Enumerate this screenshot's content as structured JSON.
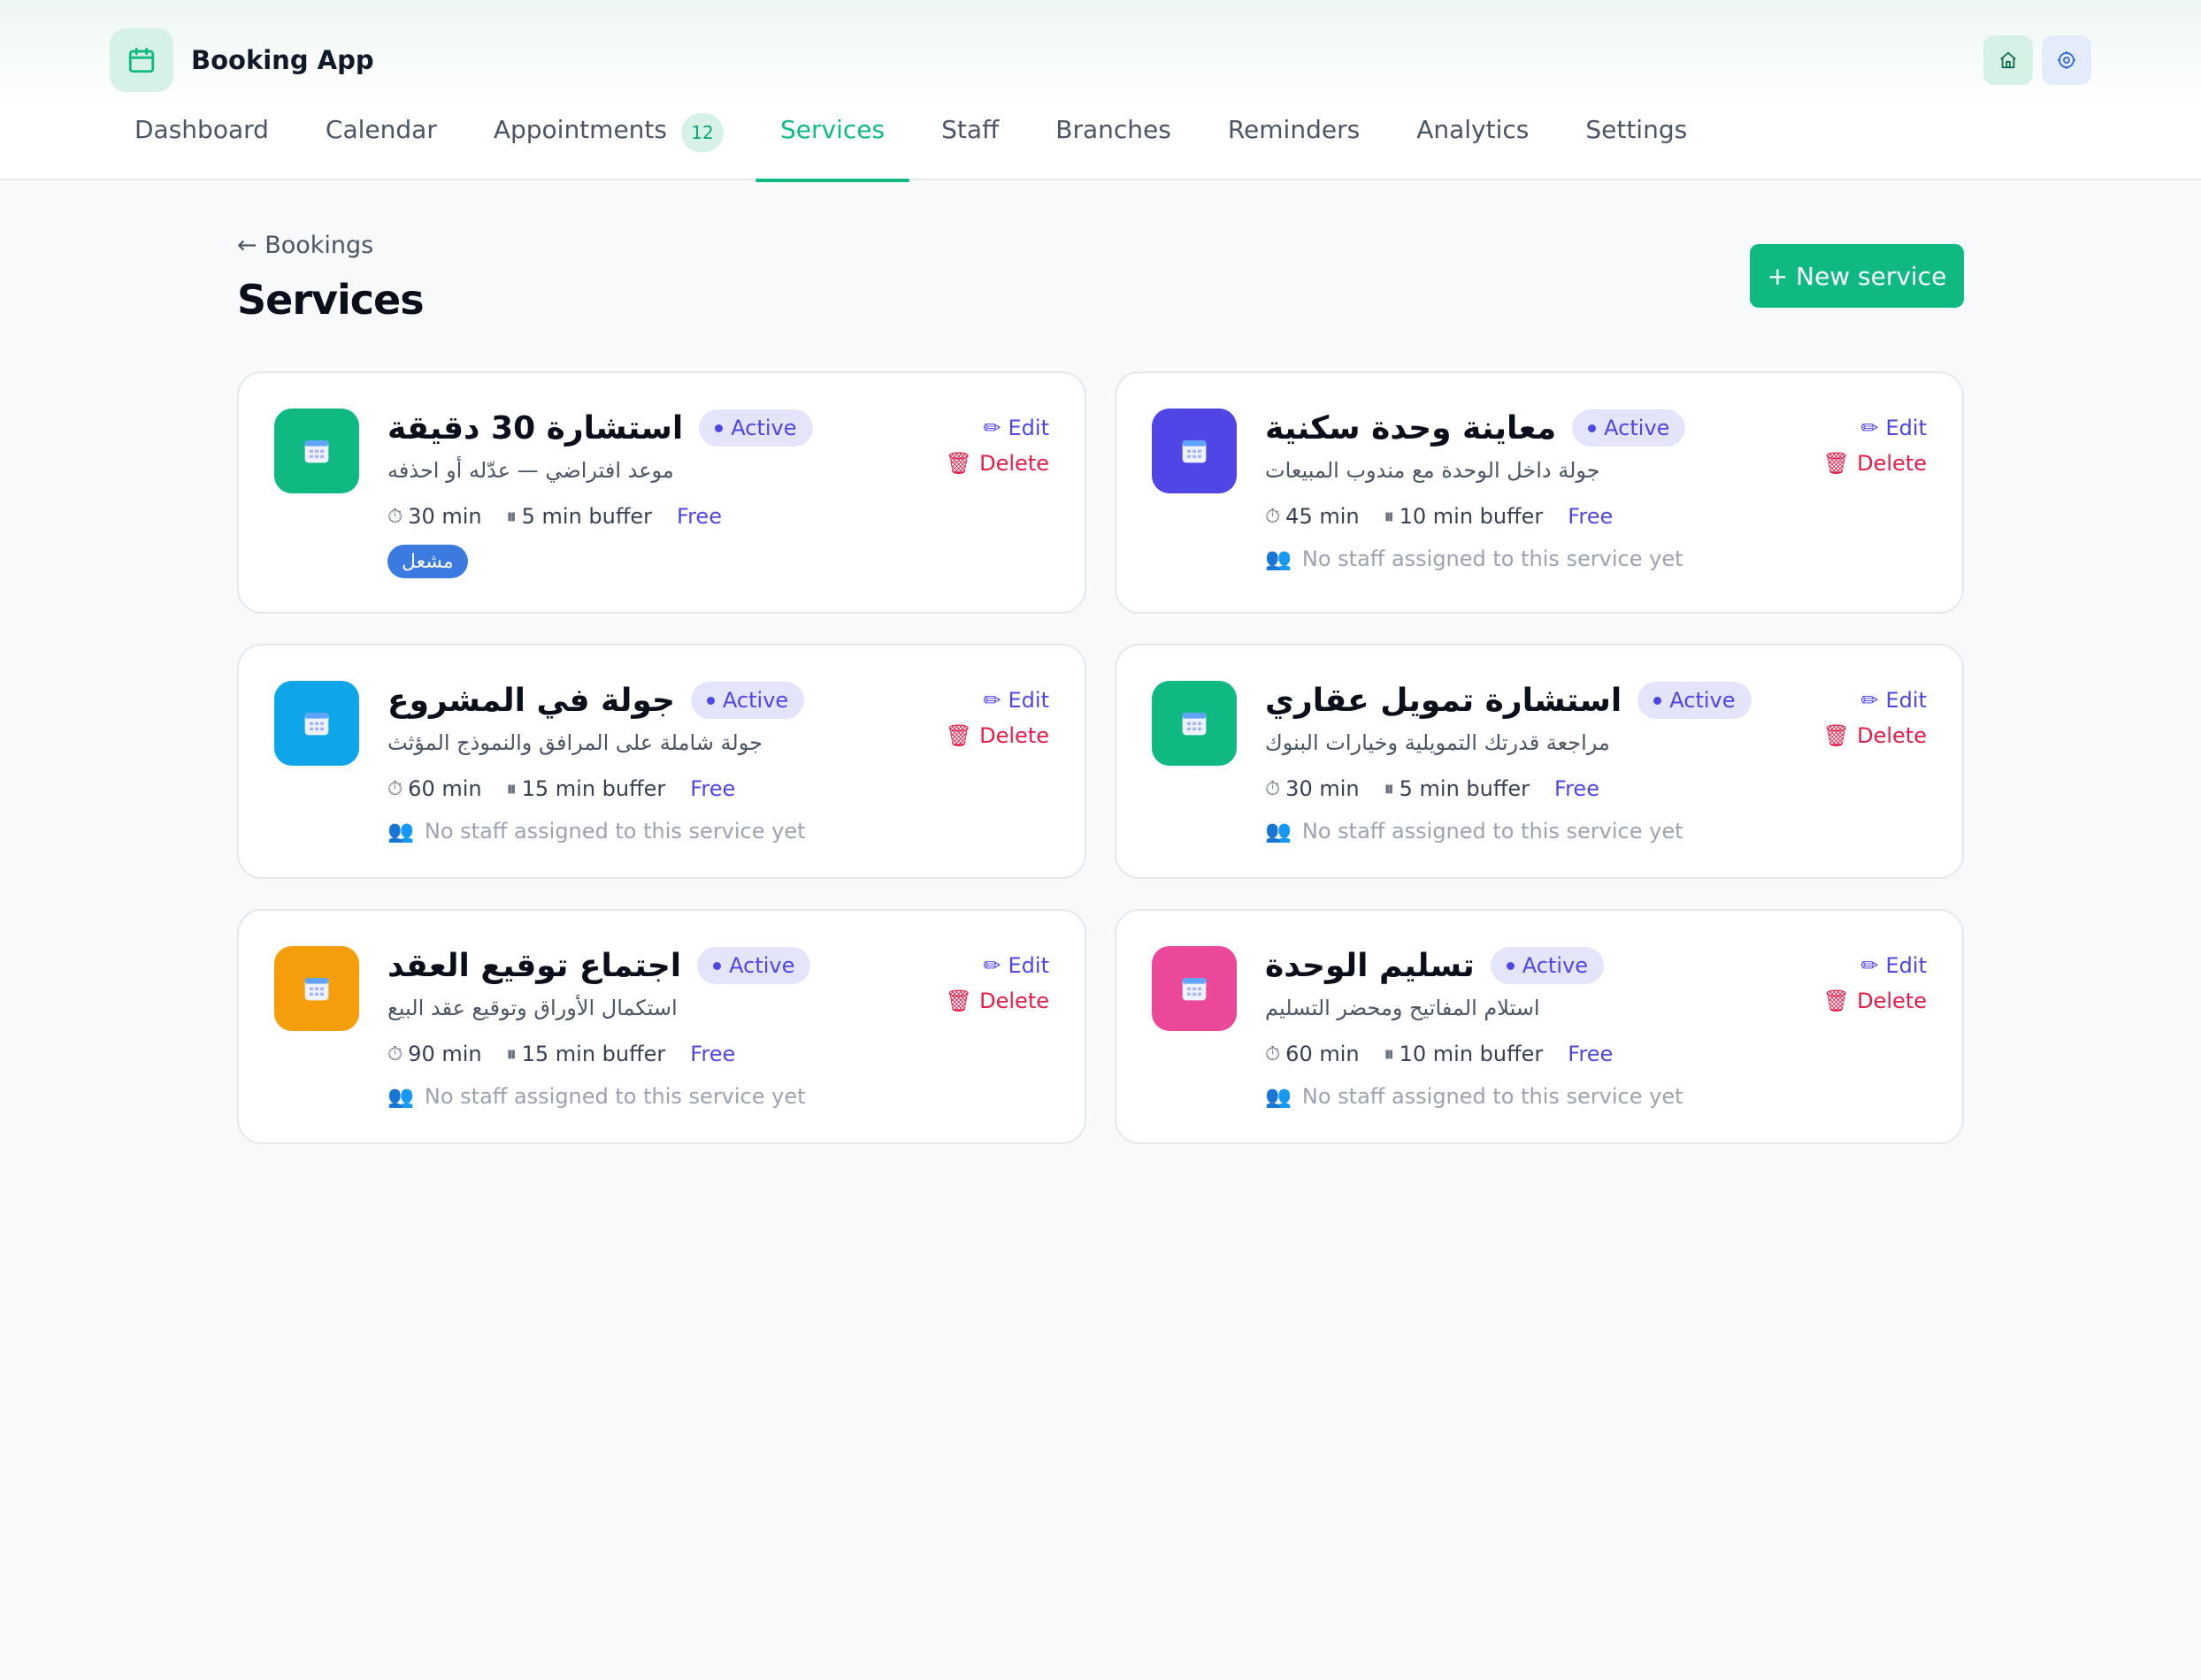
{
  "app": {
    "name": "Booking App"
  },
  "nav": [
    {
      "label": "Dashboard"
    },
    {
      "label": "Calendar"
    },
    {
      "label": "Appointments",
      "badge": "12"
    },
    {
      "label": "Services",
      "active": true
    },
    {
      "label": "Staff"
    },
    {
      "label": "Branches"
    },
    {
      "label": "Reminders"
    },
    {
      "label": "Analytics"
    },
    {
      "label": "Settings"
    }
  ],
  "page": {
    "back_label": "← Bookings",
    "title": "Services",
    "new_button": "+ New service"
  },
  "labels": {
    "edit": "Edit",
    "delete": "Delete",
    "no_staff": "No staff assigned to this service yet"
  },
  "colors": {
    "brand": "#10b981",
    "active_pill_bg": "#e4e4fb",
    "active_pill_text": "#4f46e5",
    "delete": "#e11d48"
  },
  "services": [
    {
      "name": "استشارة 30 دقيقة",
      "status": "Active",
      "description": "موعد افتراضي — عدّله أو احذفه",
      "duration": "30 min",
      "buffer": "5 min buffer",
      "price": "Free",
      "tag": "مشعل",
      "icon_color": "#10b981"
    },
    {
      "name": "معاينة وحدة سكنية",
      "status": "Active",
      "description": "جولة داخل الوحدة مع مندوب المبيعات",
      "duration": "45 min",
      "buffer": "10 min buffer",
      "price": "Free",
      "staff": "No staff assigned to this service yet",
      "icon_color": "#4f46e5"
    },
    {
      "name": "جولة في المشروع",
      "status": "Active",
      "description": "جولة شاملة على المرافق والنموذج المؤثث",
      "duration": "60 min",
      "buffer": "15 min buffer",
      "price": "Free",
      "staff": "No staff assigned to this service yet",
      "icon_color": "#0ea5e9"
    },
    {
      "name": "استشارة تمويل عقاري",
      "status": "Active",
      "description": "مراجعة قدرتك التمويلية وخيارات البنوك",
      "duration": "30 min",
      "buffer": "5 min buffer",
      "price": "Free",
      "staff": "No staff assigned to this service yet",
      "icon_color": "#10b981"
    },
    {
      "name": "اجتماع توقيع العقد",
      "status": "Active",
      "description": "استكمال الأوراق وتوقيع عقد البيع",
      "duration": "90 min",
      "buffer": "15 min buffer",
      "price": "Free",
      "staff": "No staff assigned to this service yet",
      "icon_color": "#f59e0b"
    },
    {
      "name": "تسليم الوحدة",
      "status": "Active",
      "description": "استلام المفاتيح ومحضر التسليم",
      "duration": "60 min",
      "buffer": "10 min buffer",
      "price": "Free",
      "staff": "No staff assigned to this service yet",
      "icon_color": "#ec4899"
    }
  ]
}
